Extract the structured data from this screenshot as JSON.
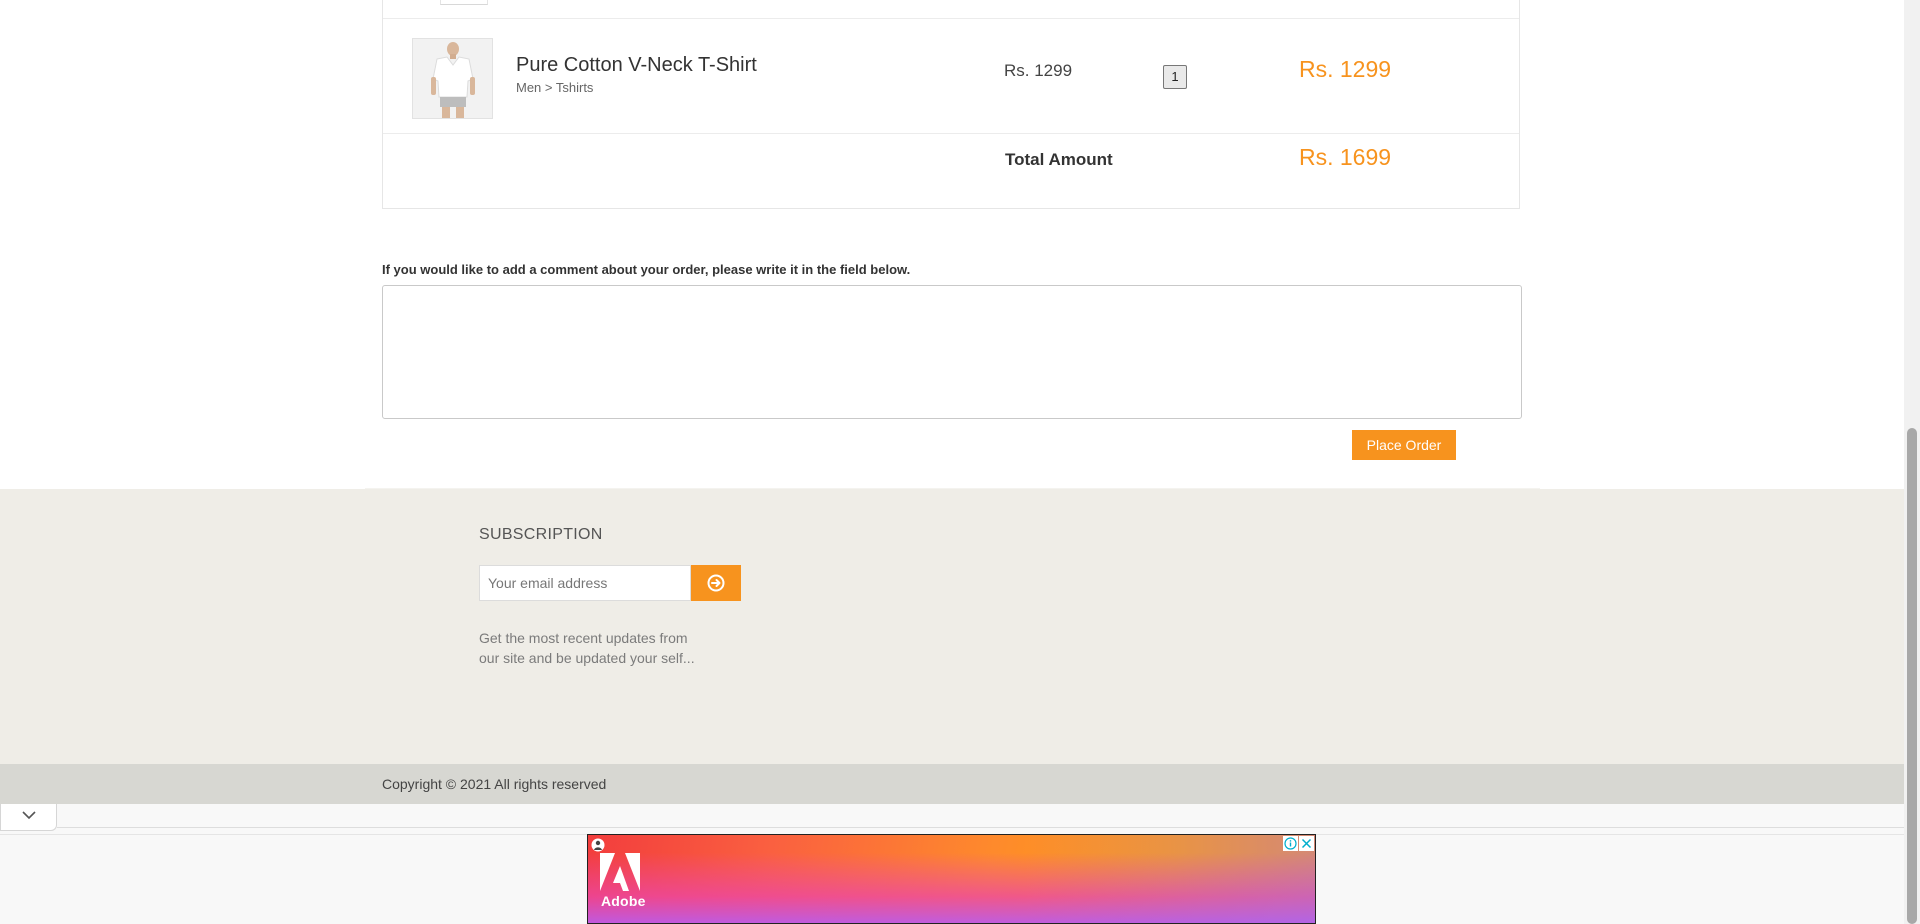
{
  "cart": {
    "item": {
      "title": "Pure Cotton V-Neck T-Shirt",
      "category": "Men > Tshirts",
      "unit_price": "Rs. 1299",
      "quantity": "1",
      "line_total": "Rs. 1299"
    },
    "total_label": "Total Amount",
    "total_value": "Rs. 1699"
  },
  "comment": {
    "label": "If you would like to add a comment about your order, please write it in the field below.",
    "value": ""
  },
  "place_order_label": "Place Order",
  "footer": {
    "subscription_title": "SUBSCRIPTION",
    "email_placeholder": "Your email address",
    "email_button_icon": "arrow-circle-right-icon",
    "description": "Get the most recent updates from our site and be updated your self...",
    "copyright": "Copyright © 2021 All rights reserved"
  },
  "ad": {
    "brand_name": "Adobe",
    "close_icon": "close-icon",
    "info_icon": "info-icon",
    "collapse_icon": "chevron-down-icon"
  },
  "colors": {
    "accent": "#f7931e",
    "footer_bg": "#efede7",
    "footer_bottom_bg": "#d7d7d2"
  }
}
